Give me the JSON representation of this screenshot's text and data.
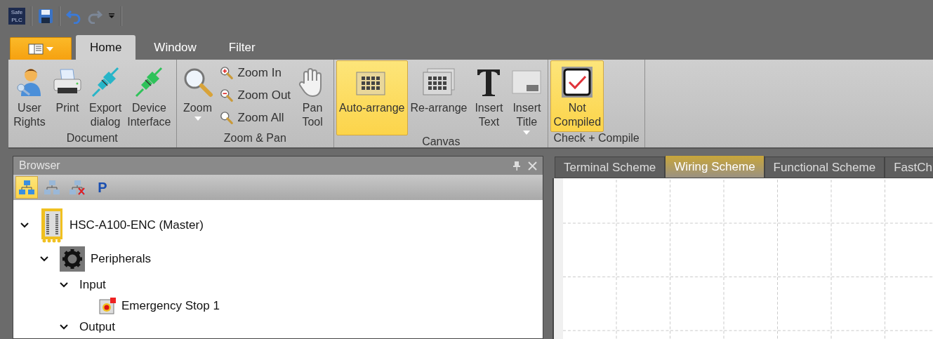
{
  "quick_access": {
    "logo": "Safe PLC"
  },
  "ribbon_tabs": [
    {
      "label": "Home",
      "selected": true
    },
    {
      "label": "Window",
      "selected": false
    },
    {
      "label": "Filter",
      "selected": false
    }
  ],
  "ribbon_groups": [
    {
      "label": "Document",
      "buttons": [
        {
          "kind": "large",
          "label": "User Rights",
          "selected": false,
          "dropdown": false
        },
        {
          "kind": "large",
          "label": "Print",
          "selected": false,
          "dropdown": false
        },
        {
          "kind": "large",
          "label": "Export dialog",
          "selected": false,
          "dropdown": false
        },
        {
          "kind": "large",
          "label": "Device Interface",
          "selected": false,
          "dropdown": false
        }
      ]
    },
    {
      "label": "Zoom & Pan",
      "buttons": [
        {
          "kind": "large",
          "label": "Zoom",
          "selected": false,
          "dropdown": true
        },
        {
          "kind": "small",
          "label": "Zoom In"
        },
        {
          "kind": "small",
          "label": "Zoom Out"
        },
        {
          "kind": "small",
          "label": "Zoom All"
        },
        {
          "kind": "large",
          "label": "Pan Tool",
          "selected": false,
          "dropdown": false
        }
      ]
    },
    {
      "label": "Canvas",
      "buttons": [
        {
          "kind": "large",
          "label": "Auto-arrange",
          "selected": true,
          "dropdown": false
        },
        {
          "kind": "large",
          "label": "Re-arrange",
          "selected": false,
          "dropdown": false
        },
        {
          "kind": "large",
          "label": "Insert Text",
          "selected": false,
          "dropdown": false
        },
        {
          "kind": "large",
          "label": "Insert Title",
          "selected": false,
          "dropdown": true
        }
      ]
    },
    {
      "label": "Check + Compile",
      "buttons": [
        {
          "kind": "large",
          "label": "Not Compiled",
          "selected": true,
          "dropdown": false
        }
      ]
    }
  ],
  "browser": {
    "title": "Browser",
    "toolbar": [
      {
        "selected": true
      },
      {
        "selected": false
      },
      {
        "selected": false
      },
      {
        "label": "P",
        "selected": false
      }
    ],
    "tree": [
      {
        "label": "HSC-A100-ENC (Master)",
        "kind": "device",
        "expanded": true,
        "children": [
          {
            "label": "Peripherals",
            "kind": "category",
            "expanded": true,
            "children": [
              {
                "label": "Input",
                "expanded": true,
                "children": [
                  {
                    "label": "Emergency Stop 1",
                    "kind": "estop"
                  }
                ]
              },
              {
                "label": "Output",
                "expanded": true
              }
            ]
          }
        ]
      }
    ]
  },
  "document_tabs": [
    {
      "label": "Terminal Scheme",
      "selected": false
    },
    {
      "label": "Wiring Scheme",
      "selected": true
    },
    {
      "label": "Functional Scheme",
      "selected": false
    },
    {
      "label": "FastCh",
      "selected": false
    }
  ]
}
